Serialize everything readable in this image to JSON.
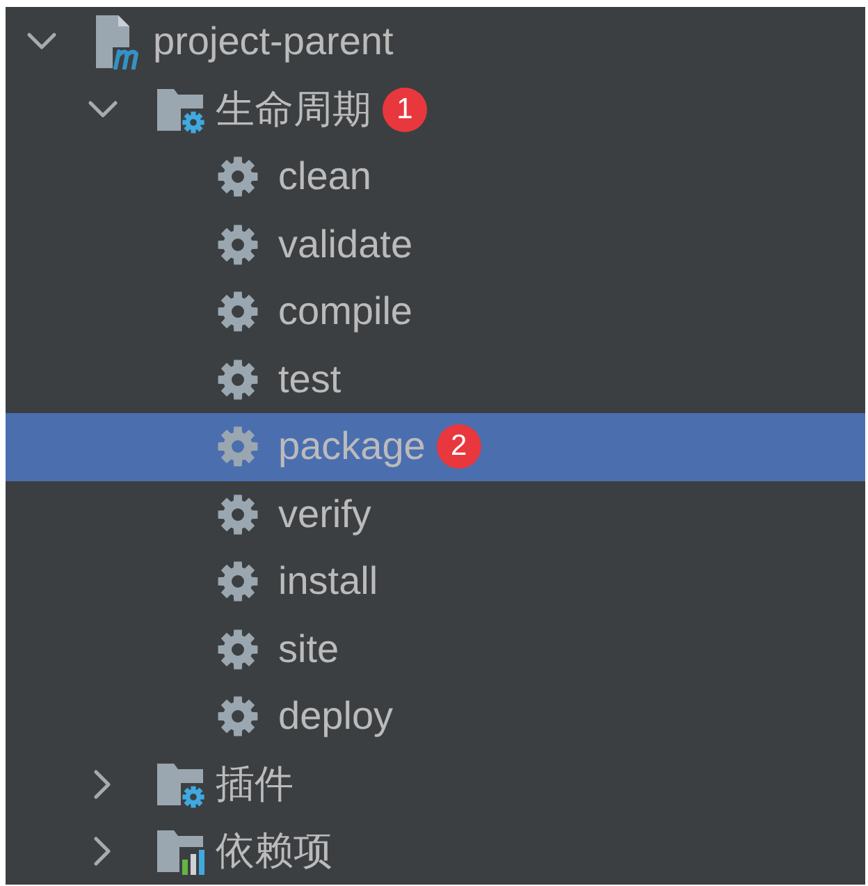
{
  "tree": [
    {
      "label": "project-parent",
      "kind": "project",
      "expanded": true,
      "selected": false,
      "children": [
        {
          "label": "生命周期",
          "kind": "config-folder",
          "expanded": true,
          "selected": false,
          "badge": "1",
          "children": [
            {
              "label": "clean",
              "kind": "goal",
              "selected": false
            },
            {
              "label": "validate",
              "kind": "goal",
              "selected": false
            },
            {
              "label": "compile",
              "kind": "goal",
              "selected": false
            },
            {
              "label": "test",
              "kind": "goal",
              "selected": false
            },
            {
              "label": "package",
              "kind": "goal",
              "selected": true,
              "badge": "2"
            },
            {
              "label": "verify",
              "kind": "goal",
              "selected": false
            },
            {
              "label": "install",
              "kind": "goal",
              "selected": false
            },
            {
              "label": "site",
              "kind": "goal",
              "selected": false
            },
            {
              "label": "deploy",
              "kind": "goal",
              "selected": false
            }
          ]
        },
        {
          "label": "插件",
          "kind": "config-folder",
          "expanded": false,
          "selected": false
        },
        {
          "label": "依赖项",
          "kind": "chart-folder",
          "expanded": false,
          "selected": false
        }
      ]
    }
  ]
}
